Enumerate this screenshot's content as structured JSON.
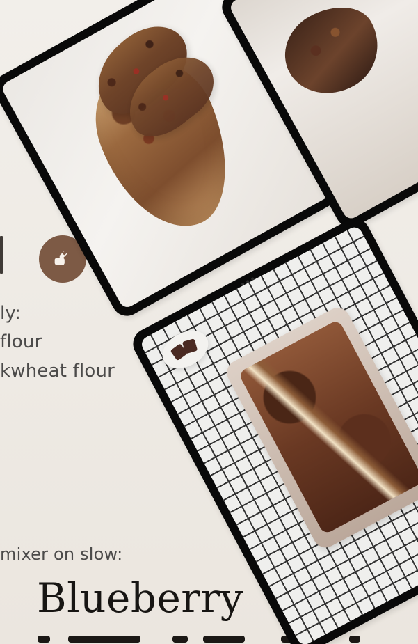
{
  "content": {
    "lines": [
      "ly:",
      "flour",
      "kwheat flour",
      "mixer on slow:"
    ],
    "title": "Blueberry"
  },
  "icons": {
    "badge_icon": "edit-icon"
  },
  "colors": {
    "background": "#efebe5",
    "badge": "#7d5a45",
    "text": "#4c4b4a",
    "title": "#171513",
    "device_frame": "#090909"
  }
}
